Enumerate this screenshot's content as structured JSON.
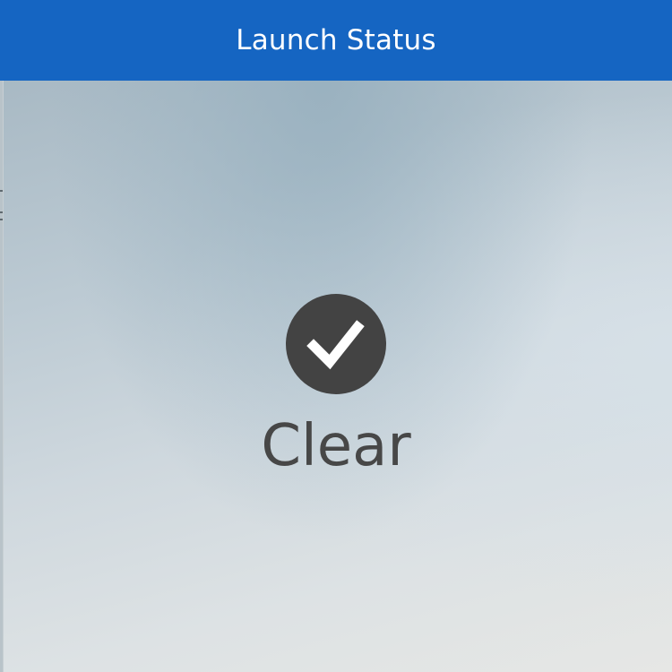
{
  "window": {
    "title": "Launch Status"
  },
  "status": {
    "label": "Clear",
    "icon": "checkmark-icon",
    "icon_color": "#434343"
  },
  "colors": {
    "navbar": "#1565c2",
    "nav_text": "#ffffff",
    "status_text": "#474747"
  }
}
